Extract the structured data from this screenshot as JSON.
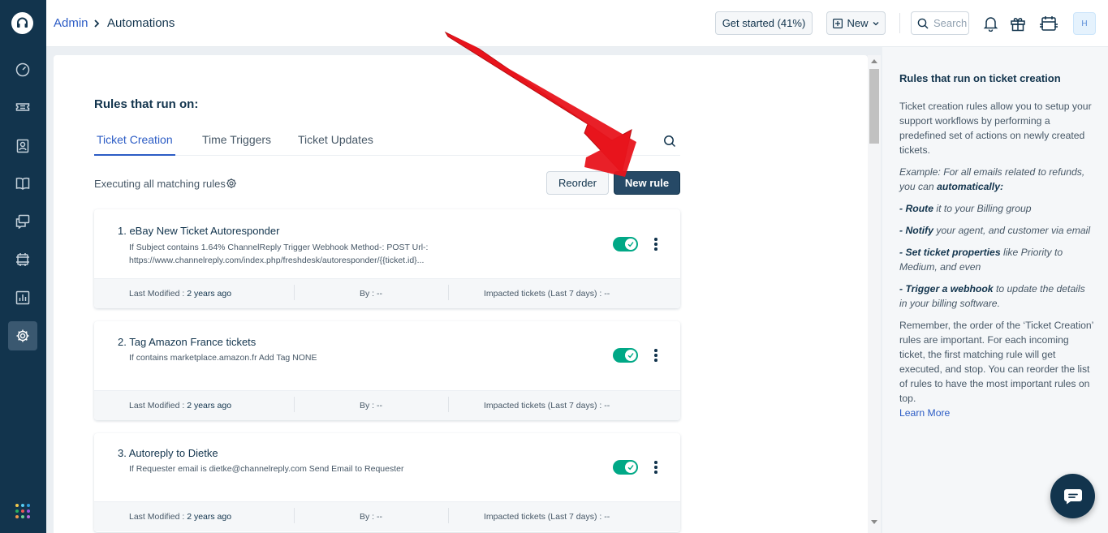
{
  "topbar": {
    "breadcrumb_parent": "Admin",
    "breadcrumb_current": "Automations",
    "get_started_label": "Get started (41%)",
    "new_label": "New",
    "search_placeholder": "Search",
    "avatar_initial": "H"
  },
  "sidebar": {
    "items": [
      "dashboard-icon",
      "tickets-icon",
      "contacts-icon",
      "solutions-icon",
      "forums-icon",
      "groups-icon",
      "reports-icon",
      "admin-icon"
    ],
    "active": "admin-icon"
  },
  "main": {
    "section_title": "Rules that run on:",
    "tabs": [
      {
        "label": "Ticket Creation",
        "active": true
      },
      {
        "label": "Time Triggers",
        "active": false
      },
      {
        "label": "Ticket Updates",
        "active": false
      }
    ],
    "executing_label": "Executing all matching rules",
    "reorder_label": "Reorder",
    "new_rule_label": "New rule",
    "rules": [
      {
        "title": "1. eBay New Ticket Autoresponder",
        "desc_line1": "If Subject contains 1.64% ChannelReply Trigger Webhook Method-: POST Url-:",
        "desc_line2": "https://www.channelreply.com/index.php/freshdesk/autoresponder/{{ticket.id}...",
        "enabled": true,
        "last_modified_label": "Last Modified : ",
        "last_modified": "2 years ago",
        "by": "By : --",
        "impacted": "Impacted tickets (Last 7 days) : --"
      },
      {
        "title": "2. Tag Amazon France tickets",
        "desc_line1": "If contains marketplace.amazon.fr Add Tag NONE",
        "desc_line2": "",
        "enabled": true,
        "last_modified_label": "Last Modified : ",
        "last_modified": "2 years ago",
        "by": "By : --",
        "impacted": "Impacted tickets (Last 7 days) : --"
      },
      {
        "title": "3. Autoreply to Dietke",
        "desc_line1": "If Requester email is dietke@channelreply.com Send Email to Requester",
        "desc_line2": "",
        "enabled": true,
        "last_modified_label": "Last Modified : ",
        "last_modified": "2 years ago",
        "by": "By : --",
        "impacted": "Impacted tickets (Last 7 days) : --"
      }
    ]
  },
  "help_panel": {
    "title": "Rules that run on ticket creation",
    "intro": "Ticket creation rules allow you to setup your support workflows by performing a predefined set of actions on newly created tickets.",
    "example_lead": "Example: For all emails related to refunds, you can ",
    "example_strong": "automatically:",
    "b1_strong": "- Route",
    "b1_rest": " it to your Billing group",
    "b2_strong": "- Notify",
    "b2_rest": " your agent, and customer via email",
    "b3_strong": "- Set ticket properties",
    "b3_rest": " like Priority to Medium, and even",
    "b4_strong": "- Trigger a webhook",
    "b4_rest": " to update the details in your billing software.",
    "order_note": "Remember, the order of the ‘Ticket Creation’ rules are important. For each incoming ticket, the first matching rule will get executed, and stop. You can reorder the list of rules to have the most important rules on top.",
    "learn_more": "Learn More"
  },
  "colors": {
    "sidebar": "#12344d",
    "accent": "#2c5cc5",
    "toggle_on": "#00a886",
    "primary_button": "#264966",
    "annotation_arrow": "#e8141c"
  }
}
